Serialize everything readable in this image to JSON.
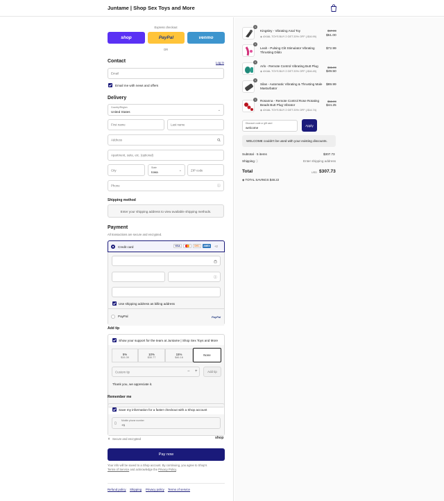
{
  "header": {
    "store_title": "Juntame | Shop Sex Toys and More",
    "bag_icon": "shopping-bag-icon"
  },
  "express": {
    "label": "Express checkout",
    "shop": "shop",
    "paypal": "PayPal",
    "venmo": "venmo",
    "or": "OR",
    "colors": {
      "shop": "#5a31f4",
      "paypal": "#ffc439",
      "venmo": "#3d95ce"
    }
  },
  "contact": {
    "heading": "Contact",
    "login": "Log in",
    "email_placeholder": "Email",
    "news_label": "Email me with news and offers"
  },
  "delivery": {
    "heading": "Delivery",
    "country_label": "Country/Region",
    "country_value": "United States",
    "first_name": "First name",
    "last_name": "Last name",
    "address": "Address",
    "apartment": "Apartment, suite, etc. (optional)",
    "city": "City",
    "state_label": "State",
    "state_value": "Iowa",
    "zip": "ZIP code",
    "phone": "Phone"
  },
  "shipping": {
    "heading": "Shipping method",
    "note": "Enter your shipping address to view available shipping methods."
  },
  "payment": {
    "heading": "Payment",
    "subtitle": "All transactions are secure and encrypted.",
    "credit_card": "Credit card",
    "more_cards": "+2",
    "cards": [
      "VISA",
      "MC",
      "DISC",
      "AMEX"
    ],
    "billing_label": "Use shipping address as billing address",
    "paypal": "PayPal",
    "paypal_logo": "PayPal"
  },
  "tip": {
    "heading": "Add tip",
    "support_label": "Show your support for the team at Juntame | Shop Sex Toys and More",
    "options": [
      {
        "pct": "5%",
        "amt": "$15.39"
      },
      {
        "pct": "10%",
        "amt": "$30.77"
      },
      {
        "pct": "15%",
        "amt": "$46.16"
      },
      {
        "pct": "None",
        "amt": ""
      }
    ],
    "custom_placeholder": "Custom tip",
    "minus": "−",
    "plus": "+",
    "add_button": "Add tip",
    "thanks": "Thank you, we appreciate it."
  },
  "remember": {
    "heading": "Remember me",
    "save_label": "Save my information for a faster checkout with a Shop account",
    "mobile_label": "Mobile phone number",
    "mobile_value": "+1",
    "secure": "Secure and encrypted",
    "shop_logo": "shop"
  },
  "pay_now": "Pay now",
  "legal": {
    "text_1": "Your info will be saved to a Shop account. By continuing, you agree to Shop's",
    "terms": "Terms of Service",
    "text_2": "and acknowledge the",
    "privacy": "Privacy Policy",
    "period": "."
  },
  "footer_links": [
    "Refund policy",
    "Shipping",
    "Privacy policy",
    "Terms of service"
  ],
  "cart": {
    "items": [
      {
        "qty": "1",
        "name": "Kingsley - Vibrating Anal Toy",
        "promo": "4X4AL TOYS BUY 2 GET 20% OFF (-$16.99)",
        "was": "$67.99",
        "price": "$51.00",
        "color": "#3a3a3a"
      },
      {
        "qty": "1",
        "name": "Leah - Pulsing Clit Stimulator Vibrating Thrusting Dildo",
        "promo": "",
        "was": "",
        "price": "$72.99",
        "color": "#d2317a"
      },
      {
        "qty": "1",
        "name": "Arlo - Remote Control Vibrating Butt Plug",
        "promo": "4X4AL TOYS BUY 2 GET 20% OFF (-$16.49)",
        "was": "$65.99",
        "price": "$49.50",
        "color": "#1f8a7a"
      },
      {
        "qty": "1",
        "name": "Silas - Automatic Vibrating & Thrusting Male Masturbator",
        "promo": "",
        "was": "",
        "price": "$89.99",
        "color": "#444444"
      },
      {
        "qty": "1",
        "name": "Rosanna - Remote Control Rose Rotating Beads Butt Plug Vibrator",
        "promo": "4X4AL TOYS BUY 2 GET 20% OFF (-$14.74)",
        "was": "$58.99",
        "price": "$44.25",
        "color": "#b8141f"
      }
    ],
    "discount_label": "Discount code or gift card",
    "discount_value": "welcome",
    "apply": "Apply",
    "discount_error": "WELCOME couldn't be used with your existing discounts.",
    "subtotal_label": "Subtotal · 5 items",
    "subtotal_value": "$307.73",
    "shipping_label": "Shipping",
    "shipping_value": "Enter shipping address",
    "total_label": "Total",
    "currency": "USD",
    "total_value": "$307.73",
    "savings_label": "TOTAL SAVINGS",
    "savings_value": "$48.22"
  }
}
